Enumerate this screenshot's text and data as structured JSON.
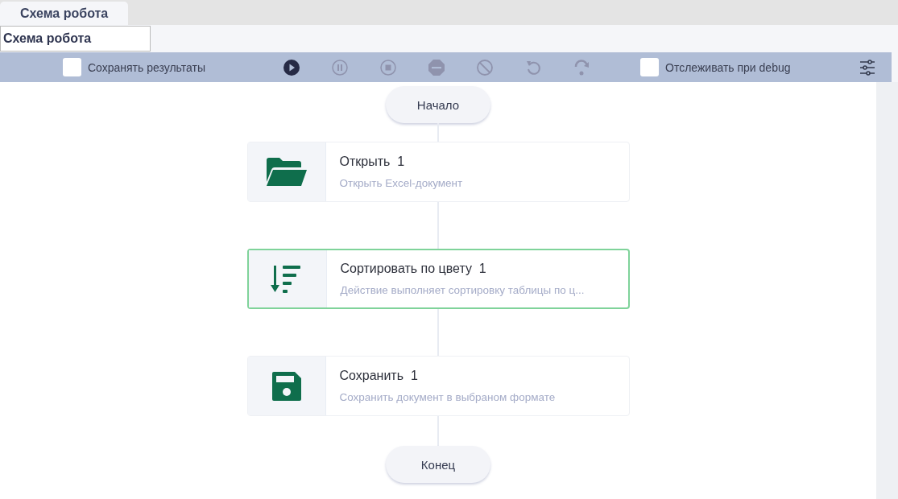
{
  "tabs": [
    {
      "label": "Схема робота",
      "selected": true
    }
  ],
  "name_field": {
    "value": "Схема робота"
  },
  "toolbar": {
    "save_results": {
      "label": "Сохранять результаты",
      "checked": false
    },
    "buttons": [
      {
        "kind": "play",
        "disabled": false
      },
      {
        "kind": "pause",
        "disabled": true
      },
      {
        "kind": "stop",
        "disabled": true
      },
      {
        "kind": "minus",
        "disabled": true
      },
      {
        "kind": "ban",
        "disabled": true
      },
      {
        "kind": "undo",
        "disabled": true
      },
      {
        "kind": "redo",
        "disabled": true
      }
    ],
    "track_debug": {
      "label": "Отслеживать при debug",
      "checked": false
    }
  },
  "flow": {
    "start": "Начало",
    "end": "Конец",
    "steps": [
      {
        "kind": "folder",
        "title": "Открыть  1",
        "description": "Открыть Excel-документ",
        "selected": false
      },
      {
        "kind": "sort",
        "title": "Сортировать по цвету  1",
        "description": "Действие выполняет сортировку таблицы по ц...",
        "selected": true
      },
      {
        "kind": "save",
        "title": "Сохранить  1",
        "description": "Сохранить документ в выбраном формате",
        "selected": false
      }
    ]
  }
}
